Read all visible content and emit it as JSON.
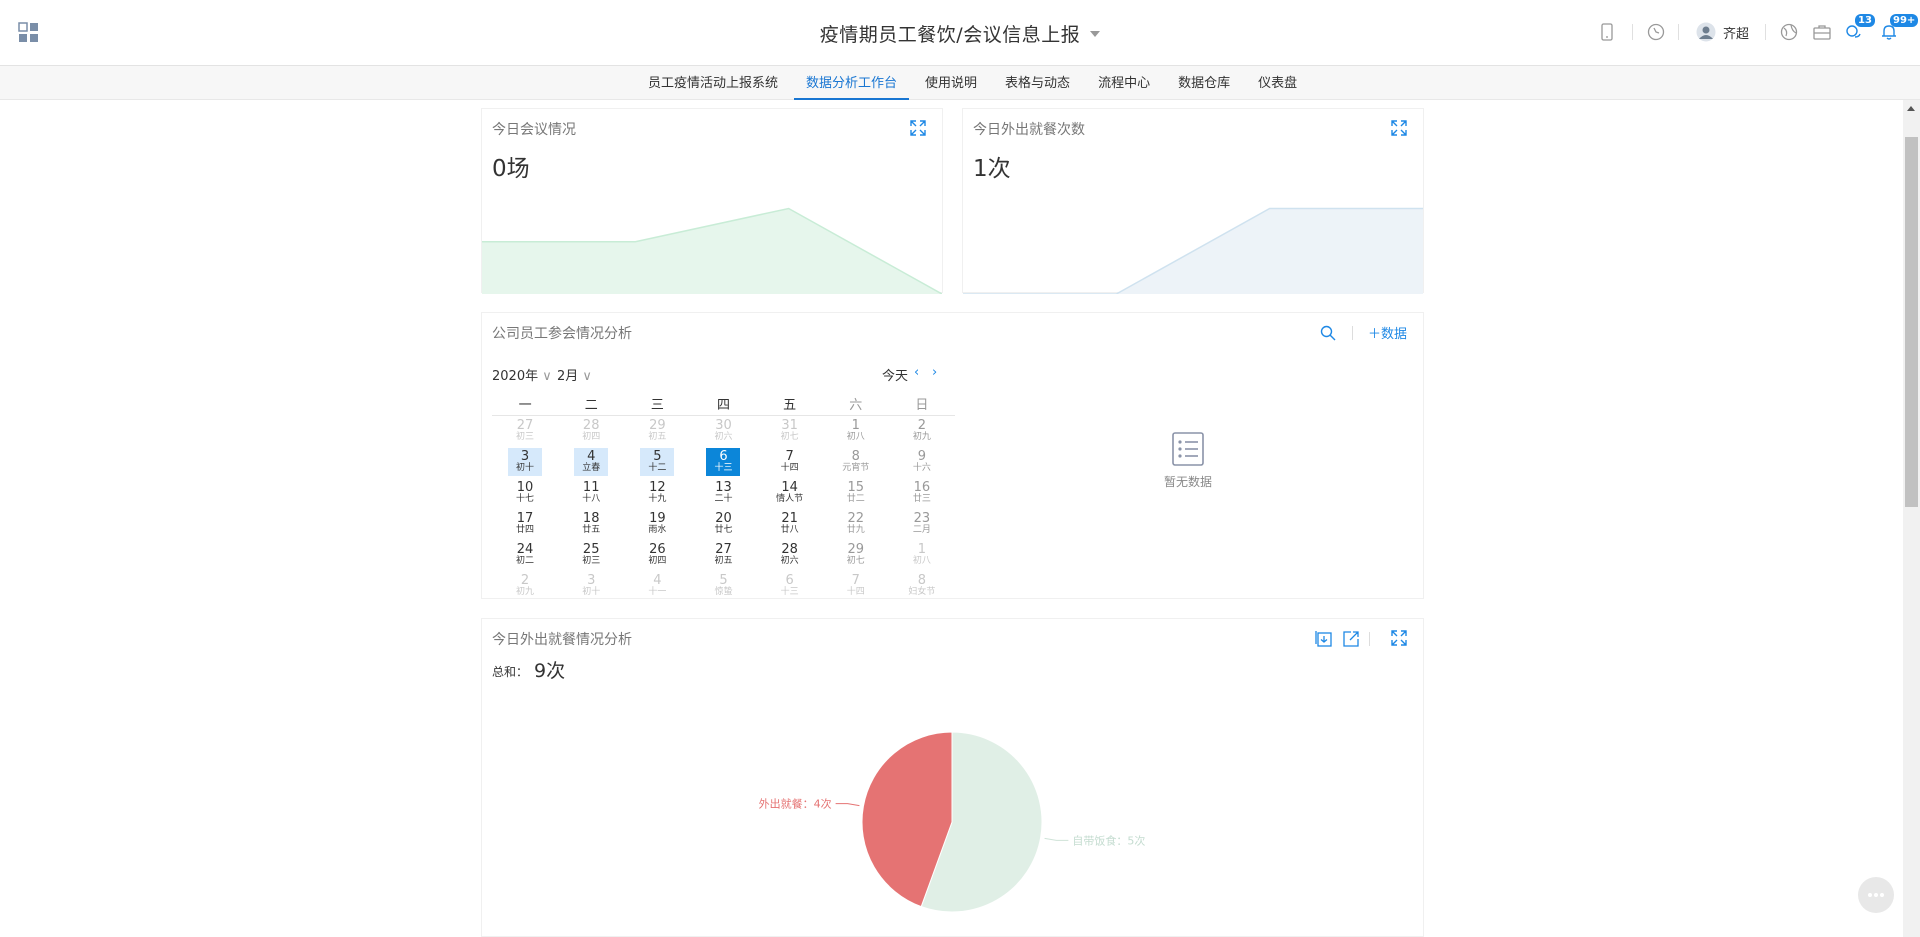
{
  "header": {
    "title": "疫情期员工餐饮/会议信息上报",
    "user_name": "齐超",
    "message_badge": "13",
    "notification_badge": "99+"
  },
  "nav": {
    "items": [
      {
        "label": "员工疫情活动上报系统",
        "active": false
      },
      {
        "label": "数据分析工作台",
        "active": true
      },
      {
        "label": "使用说明",
        "active": false
      },
      {
        "label": "表格与动态",
        "active": false
      },
      {
        "label": "流程中心",
        "active": false
      },
      {
        "label": "数据仓库",
        "active": false
      },
      {
        "label": "仪表盘",
        "active": false
      }
    ]
  },
  "meeting_card": {
    "title": "今日会议情况",
    "value": "0场",
    "sparkline": [
      0.55,
      0.55,
      0.9,
      0
    ],
    "color": "#e6f6ec",
    "line_color": "#c8ecd6"
  },
  "dining_card": {
    "title": "今日外出就餐次数",
    "value": "1次",
    "sparkline": [
      0,
      0,
      0.9,
      0.9
    ],
    "color": "#edf3f8",
    "line_color": "#cfe2ef"
  },
  "calendar_card": {
    "title": "公司员工参会情况分析",
    "add_label": "数据",
    "year": "2020年",
    "month": "2月",
    "today_label": "今天",
    "weekdays": [
      "一",
      "二",
      "三",
      "四",
      "五",
      "六",
      "日"
    ],
    "weeks": [
      [
        {
          "d": "27",
          "l": "初三",
          "o": true
        },
        {
          "d": "28",
          "l": "初四",
          "o": true
        },
        {
          "d": "29",
          "l": "初五",
          "o": true
        },
        {
          "d": "30",
          "l": "初六",
          "o": true
        },
        {
          "d": "31",
          "l": "初七",
          "o": true
        },
        {
          "d": "1",
          "l": "初八"
        },
        {
          "d": "2",
          "l": "初九"
        }
      ],
      [
        {
          "d": "3",
          "l": "初十",
          "a": true
        },
        {
          "d": "4",
          "l": "立春",
          "a": true
        },
        {
          "d": "5",
          "l": "十二",
          "a": true
        },
        {
          "d": "6",
          "l": "十三",
          "t": true
        },
        {
          "d": "7",
          "l": "十四"
        },
        {
          "d": "8",
          "l": "元宵节"
        },
        {
          "d": "9",
          "l": "十六"
        }
      ],
      [
        {
          "d": "10",
          "l": "十七"
        },
        {
          "d": "11",
          "l": "十八"
        },
        {
          "d": "12",
          "l": "十九"
        },
        {
          "d": "13",
          "l": "二十"
        },
        {
          "d": "14",
          "l": "情人节"
        },
        {
          "d": "15",
          "l": "廿二"
        },
        {
          "d": "16",
          "l": "廿三"
        }
      ],
      [
        {
          "d": "17",
          "l": "廿四"
        },
        {
          "d": "18",
          "l": "廿五"
        },
        {
          "d": "19",
          "l": "雨水"
        },
        {
          "d": "20",
          "l": "廿七"
        },
        {
          "d": "21",
          "l": "廿八"
        },
        {
          "d": "22",
          "l": "廿九"
        },
        {
          "d": "23",
          "l": "二月"
        }
      ],
      [
        {
          "d": "24",
          "l": "初二"
        },
        {
          "d": "25",
          "l": "初三"
        },
        {
          "d": "26",
          "l": "初四"
        },
        {
          "d": "27",
          "l": "初五"
        },
        {
          "d": "28",
          "l": "初六"
        },
        {
          "d": "29",
          "l": "初七"
        },
        {
          "d": "1",
          "l": "初八",
          "o": true
        }
      ],
      [
        {
          "d": "2",
          "l": "初九",
          "o": true
        },
        {
          "d": "3",
          "l": "初十",
          "o": true
        },
        {
          "d": "4",
          "l": "十一",
          "o": true
        },
        {
          "d": "5",
          "l": "惊蛰",
          "o": true
        },
        {
          "d": "6",
          "l": "十三",
          "o": true
        },
        {
          "d": "7",
          "l": "十四",
          "o": true
        },
        {
          "d": "8",
          "l": "妇女节",
          "o": true
        }
      ]
    ],
    "empty_text": "暂无数据"
  },
  "pie_card": {
    "title": "今日外出就餐情况分析",
    "total_label": "总和：",
    "total_value": "9次"
  },
  "chart_data": {
    "type": "pie",
    "series": [
      {
        "name": "外出就餐",
        "value": 4,
        "label": "外出就餐：4次",
        "color": "#e57373"
      },
      {
        "name": "自带饭食",
        "value": 5,
        "label": "自带饭食：5次",
        "color": "#e0efe6"
      }
    ]
  }
}
